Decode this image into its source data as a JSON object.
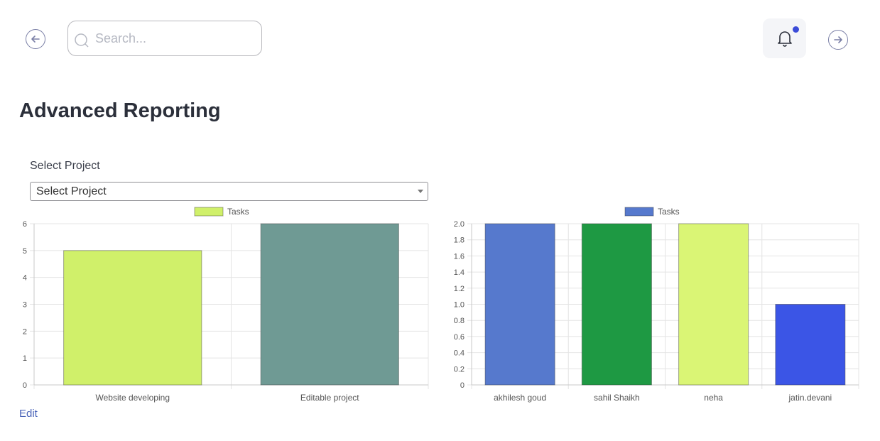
{
  "header": {
    "search_placeholder": "Search...",
    "back_icon": "arrow-left-circle-icon",
    "forward_icon": "arrow-right-circle-icon",
    "notification_icon": "bell-icon",
    "notification_dot_color": "#3b4bd8"
  },
  "page": {
    "title": "Advanced Reporting",
    "select_label": "Select Project",
    "select_value": "Select Project",
    "edit_label": "Edit"
  },
  "chart_data": [
    {
      "type": "bar",
      "categories": [
        "Website developing",
        "Editable project"
      ],
      "series": [
        {
          "name": "Tasks",
          "values": [
            5,
            6
          ]
        }
      ],
      "bar_colors": [
        "#d0f06a",
        "#6f9a94"
      ],
      "ylim": [
        0,
        6
      ],
      "yticks": [
        "0",
        "1",
        "2",
        "3",
        "4",
        "5",
        "6"
      ],
      "legend_position": "top",
      "grid": true
    },
    {
      "type": "bar",
      "categories": [
        "akhilesh goud",
        "sahil Shaikh",
        "neha",
        "jatin.devani"
      ],
      "series": [
        {
          "name": "Tasks",
          "values": [
            2,
            2,
            2,
            1
          ]
        }
      ],
      "bar_colors": [
        "#5679cd",
        "#1e9943",
        "#daf575",
        "#3b55e6"
      ],
      "ylim": [
        0,
        2
      ],
      "yticks": [
        "0",
        "0.2",
        "0.4",
        "0.6",
        "0.8",
        "1.0",
        "1.2",
        "1.4",
        "1.6",
        "1.8",
        "2.0"
      ],
      "legend_position": "top",
      "grid": true
    }
  ]
}
